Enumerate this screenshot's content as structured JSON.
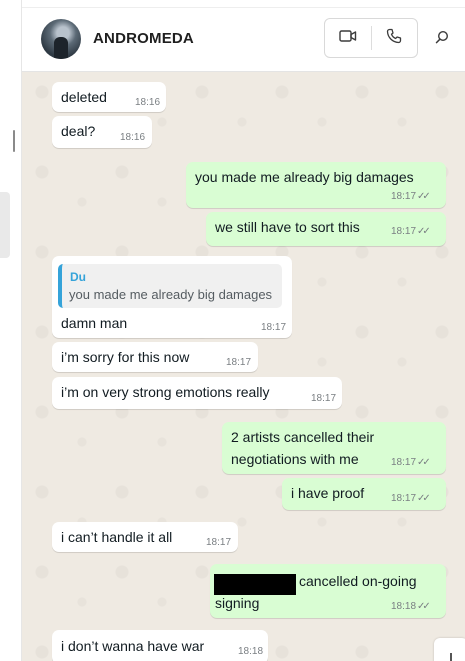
{
  "header": {
    "contact_name": "ANDROMEDA",
    "icons": [
      "video-call-icon",
      "voice-call-icon",
      "search-icon"
    ]
  },
  "messages": [
    {
      "direction": "in",
      "text": "deleted",
      "time": "18:16"
    },
    {
      "direction": "in",
      "text": "deal?",
      "time": "18:16"
    },
    {
      "direction": "out",
      "text": "you made me already big damages",
      "time": "18:17",
      "ticks": "✓✓"
    },
    {
      "direction": "out",
      "text": "we still have to sort this",
      "time": "18:17",
      "ticks": "✓✓"
    },
    {
      "direction": "in",
      "quote_author": "Du",
      "quote_text": "you made me already big damages",
      "text": "damn man",
      "time": "18:17"
    },
    {
      "direction": "in",
      "text": "i’m sorry for this now",
      "time": "18:17"
    },
    {
      "direction": "in",
      "text": "i’m on very strong emotions really",
      "time": "18:17"
    },
    {
      "direction": "out",
      "text_line1": "2 artists cancelled their",
      "text_line2": "negotiations with me",
      "time": "18:17",
      "ticks": "✓✓"
    },
    {
      "direction": "out",
      "text": "i have proof",
      "time": "18:17",
      "ticks": "✓✓"
    },
    {
      "direction": "in",
      "text": "i can’t handle it all",
      "time": "18:17"
    },
    {
      "direction": "out",
      "text_line1": "cancelled on-going",
      "text_line2": "signing",
      "time": "18:18",
      "ticks": "✓✓",
      "redacted": true
    },
    {
      "direction": "in",
      "text": "i don’t wanna have war",
      "time": "18:18"
    }
  ],
  "colors": {
    "chat_background": "#efeae2",
    "incoming_bubble": "#ffffff",
    "outgoing_bubble": "#d9fdd3",
    "quote_accent": "#35a3d9"
  }
}
